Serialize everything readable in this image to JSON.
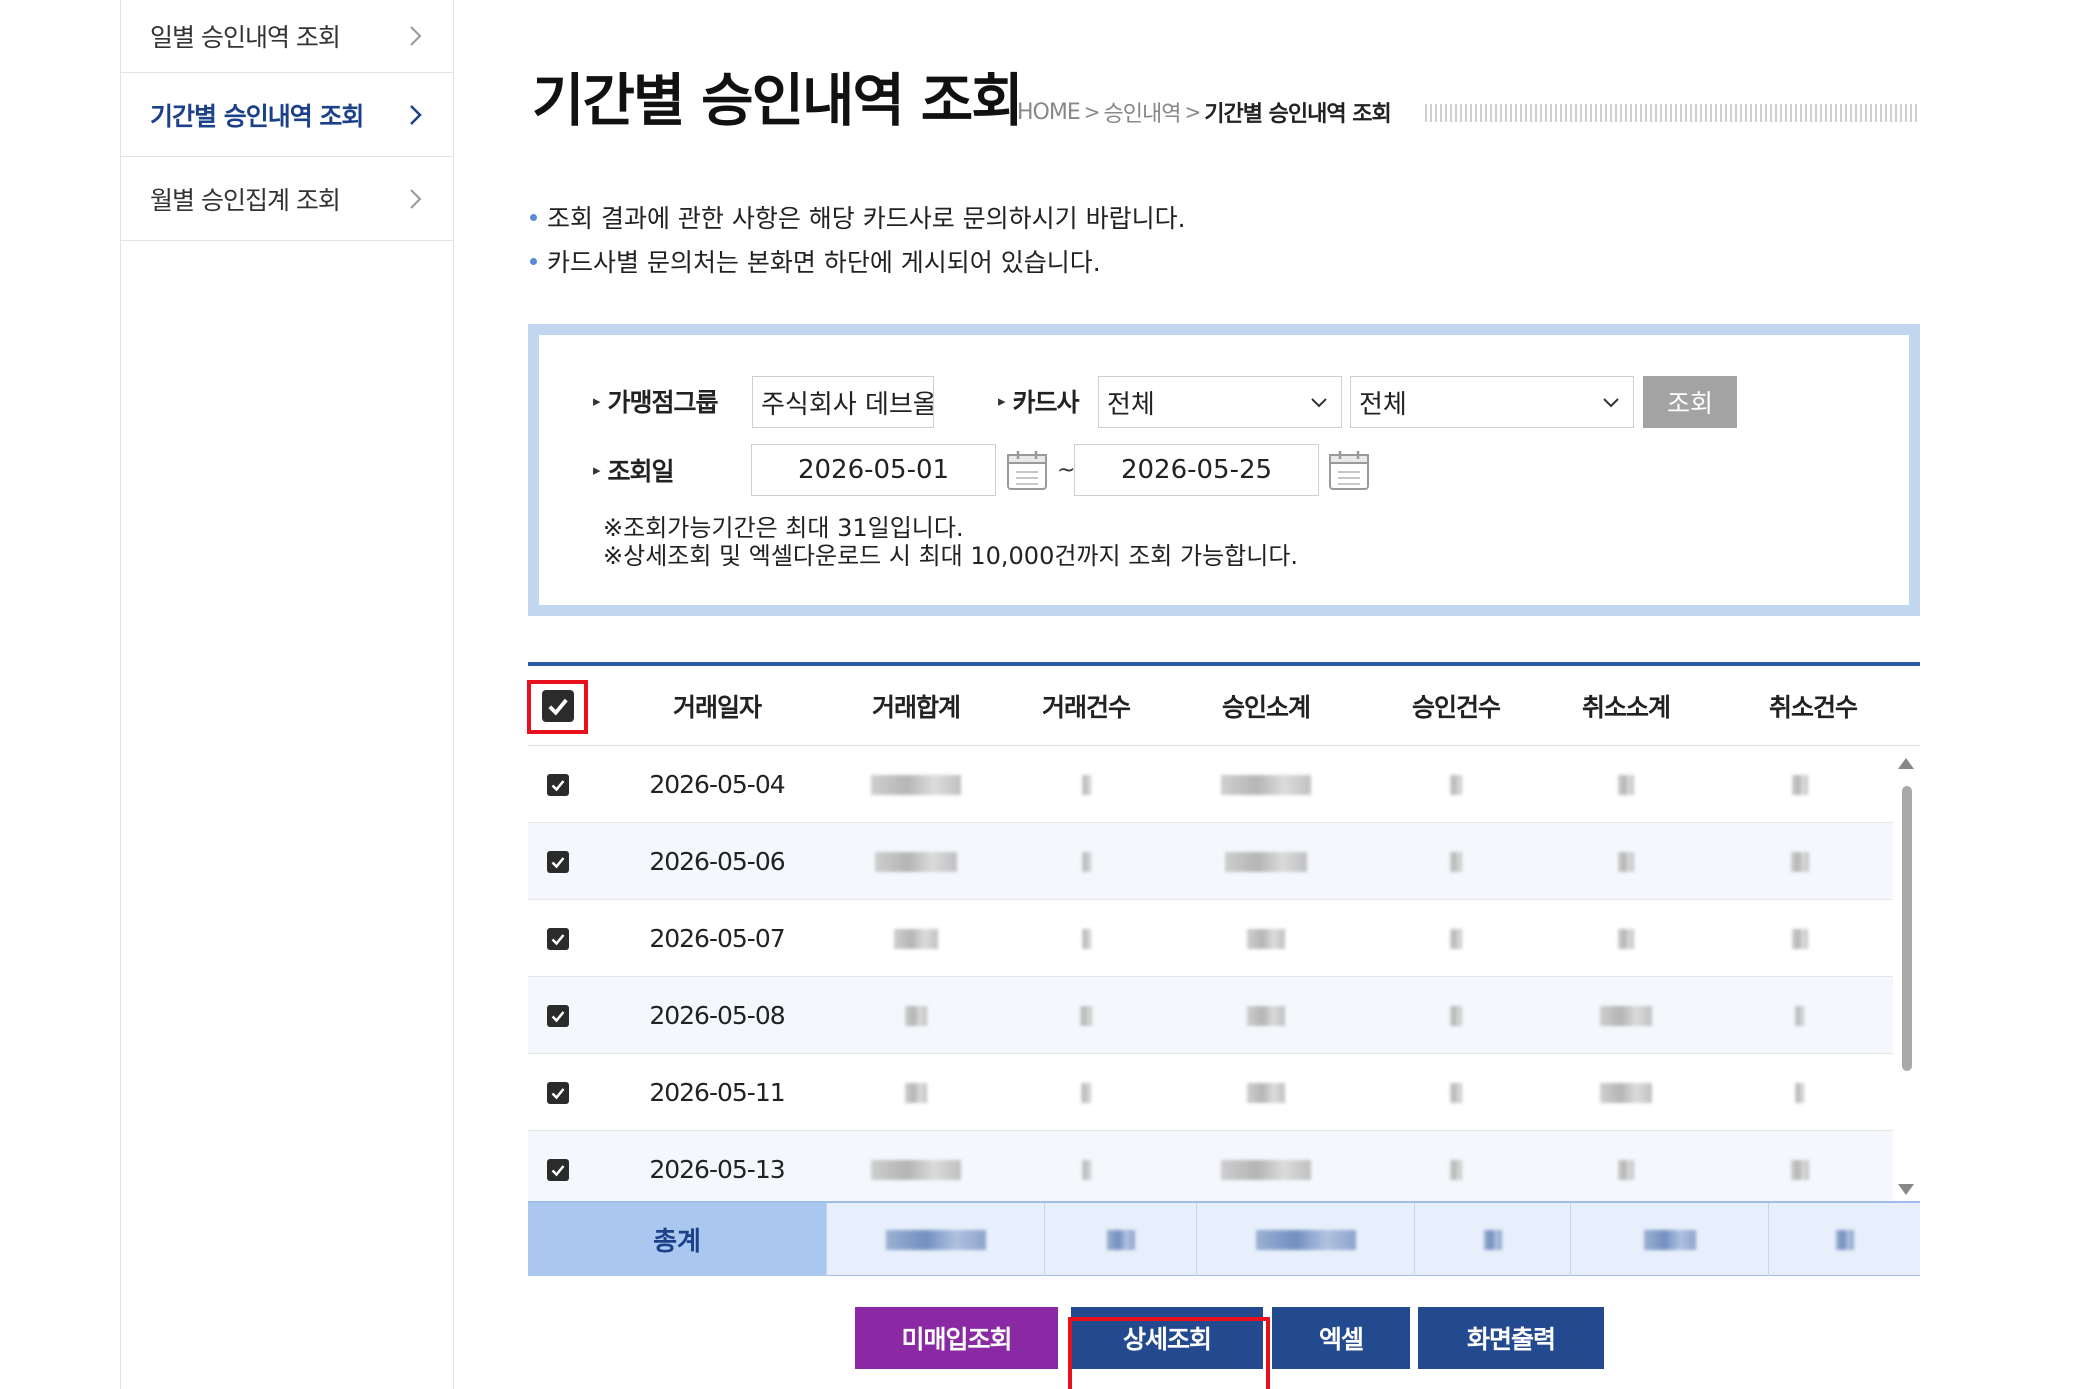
{
  "sidebar": {
    "items": [
      {
        "label": "일별 승인내역 조회",
        "active": false
      },
      {
        "label": "기간별 승인내역 조회",
        "active": true
      },
      {
        "label": "월별 승인집계 조회",
        "active": false
      }
    ]
  },
  "header": {
    "title": "기간별 승인내역 조회",
    "breadcrumb": [
      "HOME",
      "승인내역",
      "기간별 승인내역 조회"
    ]
  },
  "notices": [
    "조회 결과에 관한 사항은 해당 카드사로 문의하시기 바랍니다.",
    "카드사별 문의처는 본화면 하단에 게시되어 있습니다."
  ],
  "search": {
    "merchant_group_label": "가맹점그룹",
    "merchant_group_value": "주식회사 데브올컴퍼",
    "card_company_label": "카드사",
    "card_company_select_1": "전체",
    "card_company_select_2": "전체",
    "search_button": "조회",
    "date_label": "조회일",
    "date_from": "2026-05-01",
    "date_separator": "~",
    "date_to": "2026-05-25",
    "hint_1": "※조회가능기간은 최대 31일입니다.",
    "hint_2": "※상세조회 및 엑셀다운로드 시 최대 10,000건까지 조회 가능합니다."
  },
  "table": {
    "header_checked": true,
    "columns": [
      "거래일자",
      "거래합계",
      "거래건수",
      "승인소계",
      "승인건수",
      "취소소계",
      "취소건수"
    ],
    "rows": [
      {
        "checked": true,
        "date": "2026-05-04"
      },
      {
        "checked": true,
        "date": "2026-05-06"
      },
      {
        "checked": true,
        "date": "2026-05-07"
      },
      {
        "checked": true,
        "date": "2026-05-08"
      },
      {
        "checked": true,
        "date": "2026-05-11"
      },
      {
        "checked": true,
        "date": "2026-05-13"
      }
    ],
    "total_label": "총계"
  },
  "buttons": {
    "unpurchased": "미매입조회",
    "detail": "상세조회",
    "excel": "엑셀",
    "print": "화면출력"
  },
  "colors": {
    "accent_navy": "#1c4189",
    "button_purple": "#8a29a3",
    "button_navy": "#234a8f",
    "highlight_red": "#e8101c",
    "search_box_border": "#c2d6ef"
  }
}
